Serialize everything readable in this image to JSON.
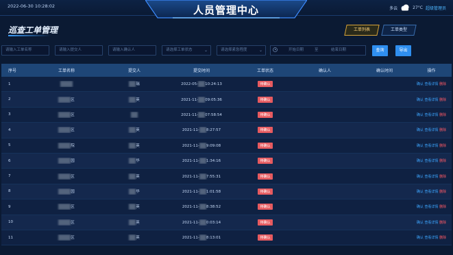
{
  "header": {
    "datetime": "2022-06-30 10:28:02",
    "title": "人员管理中心",
    "weather": "多云",
    "temperature": "27°C",
    "user": "超级管理员"
  },
  "section": {
    "title": "巡查工单管理",
    "tabs": [
      {
        "label": "工单列表",
        "active": true
      },
      {
        "label": "工单类型",
        "active": false
      }
    ]
  },
  "filters": {
    "name_placeholder": "请输入工单名称",
    "submitter_placeholder": "请输入提交人",
    "confirmer_placeholder": "请输入确认人",
    "status_placeholder": "请选择工单状态",
    "urgency_placeholder": "请选择紧急程度",
    "start_date": "开始日期",
    "date_sep": "至",
    "end_date": "结束日期",
    "search_label": "查询",
    "export_label": "导出"
  },
  "table": {
    "headers": [
      "序号",
      "工单名称",
      "提交人",
      "提交时间",
      "工单状态",
      "确认人",
      "确认时间",
      "操作"
    ],
    "ops": {
      "confirm": "确认",
      "detail": "查看详情",
      "delete": "删除"
    },
    "rows": [
      {
        "index": "1",
        "name_suffix": "",
        "submitter_suffix": "瑞",
        "time_prefix": "2022-05-",
        "time_suffix": "10:24:13",
        "status": "待确认"
      },
      {
        "index": "2",
        "name_suffix": "区",
        "submitter_suffix": "英",
        "time_prefix": "2021-11-",
        "time_suffix": "09:05:36",
        "status": "待确认"
      },
      {
        "index": "3",
        "name_suffix": "区",
        "submitter_suffix": "",
        "time_prefix": "2021-11-",
        "time_suffix": "07:58:54",
        "status": "待确认"
      },
      {
        "index": "4",
        "name_suffix": "区",
        "submitter_suffix": "英",
        "time_prefix": "2021-11-",
        "time_suffix": "8:27:57",
        "status": "待确认"
      },
      {
        "index": "5",
        "name_suffix": "院",
        "submitter_suffix": "英",
        "time_prefix": "2021-11-",
        "time_suffix": "9:09:08",
        "status": "待确认"
      },
      {
        "index": "6",
        "name_suffix": "园",
        "submitter_suffix": "华",
        "time_prefix": "2021-11-",
        "time_suffix": "1:34:16",
        "status": "待确认"
      },
      {
        "index": "7",
        "name_suffix": "区",
        "submitter_suffix": "英",
        "time_prefix": "2021-11-",
        "time_suffix": "7:55:31",
        "status": "待确认"
      },
      {
        "index": "8",
        "name_suffix": "园",
        "submitter_suffix": "华",
        "time_prefix": "2021-11-",
        "time_suffix": "1:01:58",
        "status": "待确认"
      },
      {
        "index": "9",
        "name_suffix": "区",
        "submitter_suffix": "英",
        "time_prefix": "2021-11-",
        "time_suffix": "8:38:52",
        "status": "待确认"
      },
      {
        "index": "10",
        "name_suffix": "区",
        "submitter_suffix": "英",
        "time_prefix": "2021-11-",
        "time_suffix": "0:03:14",
        "status": "待确认"
      },
      {
        "index": "11",
        "name_suffix": "区",
        "submitter_suffix": "英",
        "time_prefix": "2021-11-",
        "time_suffix": "8:13:01",
        "status": "待确认"
      }
    ]
  },
  "colors": {
    "accent": "#2f8ff0",
    "pending": "#e65a5f",
    "header_row": "#1e4677"
  }
}
